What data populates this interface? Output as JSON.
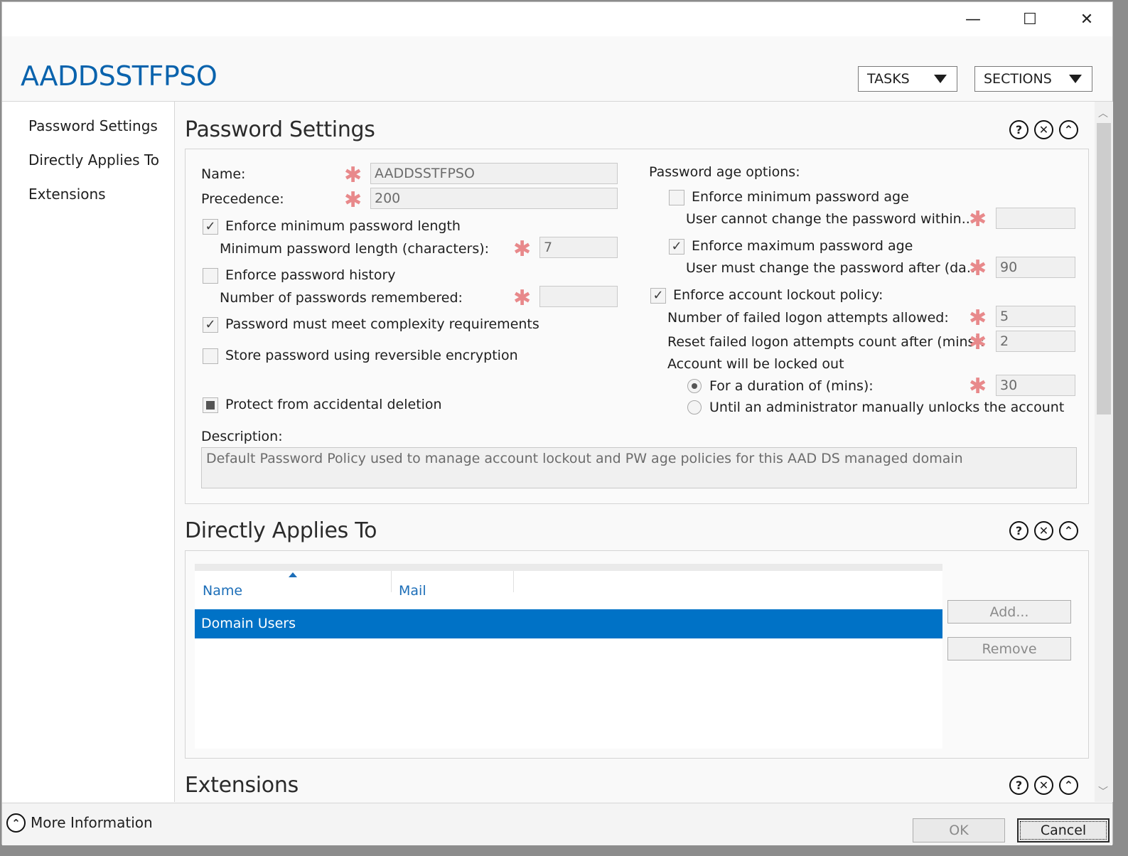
{
  "window": {
    "title": "AADDSSTFPSO",
    "controls": {
      "minimize": "—",
      "maximize": "☐",
      "close": "✕"
    }
  },
  "toolbar": {
    "tasks_label": "TASKS",
    "sections_label": "SECTIONS"
  },
  "nav": {
    "items": [
      {
        "label": "Password Settings"
      },
      {
        "label": "Directly Applies To"
      },
      {
        "label": "Extensions"
      }
    ]
  },
  "password_settings": {
    "title": "Password Settings",
    "name_label": "Name:",
    "name_value": "AADDSSTFPSO",
    "precedence_label": "Precedence:",
    "precedence_value": "200",
    "enforce_min_length": {
      "label": "Enforce minimum password length",
      "checked": true
    },
    "min_length_label": "Minimum password length (characters):",
    "min_length_value": "7",
    "enforce_history": {
      "label": "Enforce password history",
      "checked": false
    },
    "history_label": "Number of passwords remembered:",
    "history_value": "",
    "complexity": {
      "label": "Password must meet complexity requirements",
      "checked": true
    },
    "reversible": {
      "label": "Store password using reversible encryption",
      "checked": false
    },
    "protect": {
      "label": "Protect from accidental deletion",
      "state": "partial"
    },
    "age_options_label": "Password age options:",
    "enforce_min_age": {
      "label": "Enforce minimum password age",
      "checked": false
    },
    "min_age_label": "User cannot change the password within...",
    "min_age_value": "",
    "enforce_max_age": {
      "label": "Enforce maximum password age",
      "checked": true
    },
    "max_age_label": "User must change the password after (da...",
    "max_age_value": "90",
    "lockout": {
      "label": "Enforce account lockout policy:",
      "checked": true
    },
    "failed_attempts_label": "Number of failed logon attempts allowed:",
    "failed_attempts_value": "5",
    "reset_label": "Reset failed logon attempts count after (mins):",
    "reset_value": "2",
    "locked_out_label": "Account will be locked out",
    "duration_option": {
      "label": "For a duration of (mins):",
      "selected": true
    },
    "duration_value": "30",
    "manual_option": {
      "label": "Until an administrator manually unlocks the account",
      "selected": false
    },
    "description_label": "Description:",
    "description_value": "Default Password Policy used to manage account lockout and PW age policies for this AAD DS managed domain"
  },
  "applies_to": {
    "title": "Directly Applies To",
    "columns": [
      "Name",
      "Mail"
    ],
    "rows": [
      {
        "name": "Domain Users",
        "mail": ""
      }
    ],
    "add_label": "Add...",
    "remove_label": "Remove"
  },
  "extensions": {
    "title": "Extensions"
  },
  "section_icons": {
    "help": "?",
    "close": "✕",
    "collapse": "⌃"
  },
  "footer": {
    "more_info_label": "More Information",
    "ok_label": "OK",
    "cancel_label": "Cancel"
  },
  "colors": {
    "accent": "#0a63ad",
    "selection": "#0072c6",
    "required": "#e8898b"
  }
}
